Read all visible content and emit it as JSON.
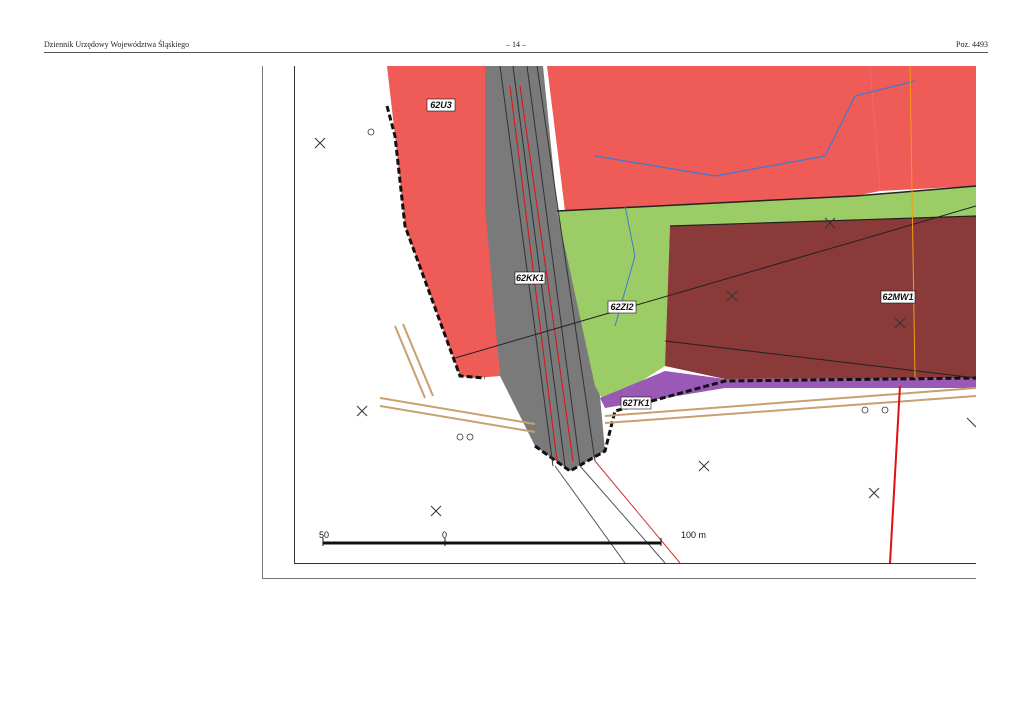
{
  "header": {
    "left": "Dziennik Urzędowy Województwa Śląskiego",
    "center": "– 14 –",
    "right": "Poz. 4493"
  },
  "zones": {
    "u3": "62U3",
    "kk1": "62KK1",
    "zi2": "62ZI2",
    "mw1": "62MW1",
    "tk1": "62TK1"
  },
  "scale": {
    "left": "50",
    "zero": "0",
    "right": "100 m"
  },
  "colors": {
    "service": "#ef5b57",
    "rail": "#7a7a7a",
    "green": "#9ccc65",
    "residential": "#8b3a3a",
    "road": "#9b59b6",
    "boundary": "#111111"
  }
}
